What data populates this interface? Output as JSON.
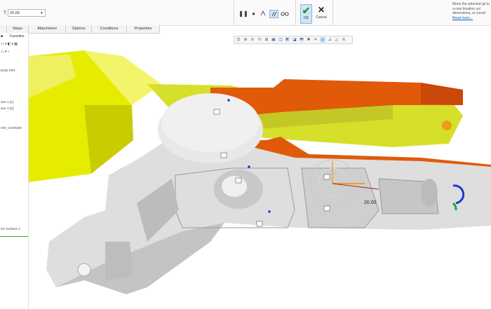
{
  "ribbon": {
    "time_label": "T:",
    "time_value": "20.00",
    "ok_label": "OK",
    "cancel_label": "Cancel",
    "help_text": "Move the selected ge to a new location usi dimensions, or consti",
    "help_link": "Read more..."
  },
  "tabs": [
    "Steps",
    "Attachment",
    "Options",
    "Conditions",
    "Properties"
  ],
  "left_panel": {
    "favorites": "Favorites",
    "rows": [
      "ENG.PRT",
      "ace 1 [1]",
      "ace 1 [2]",
      "GR_CHANGE",
      "hic Surface 1"
    ]
  },
  "viewport": {
    "dimension_value": "20.00"
  },
  "colors": {
    "yellow_part": "#e6ec00",
    "orange_part": "#e05a0a",
    "gray_part": "#d4d4d4",
    "accent_blue": "#8fb6dd"
  }
}
